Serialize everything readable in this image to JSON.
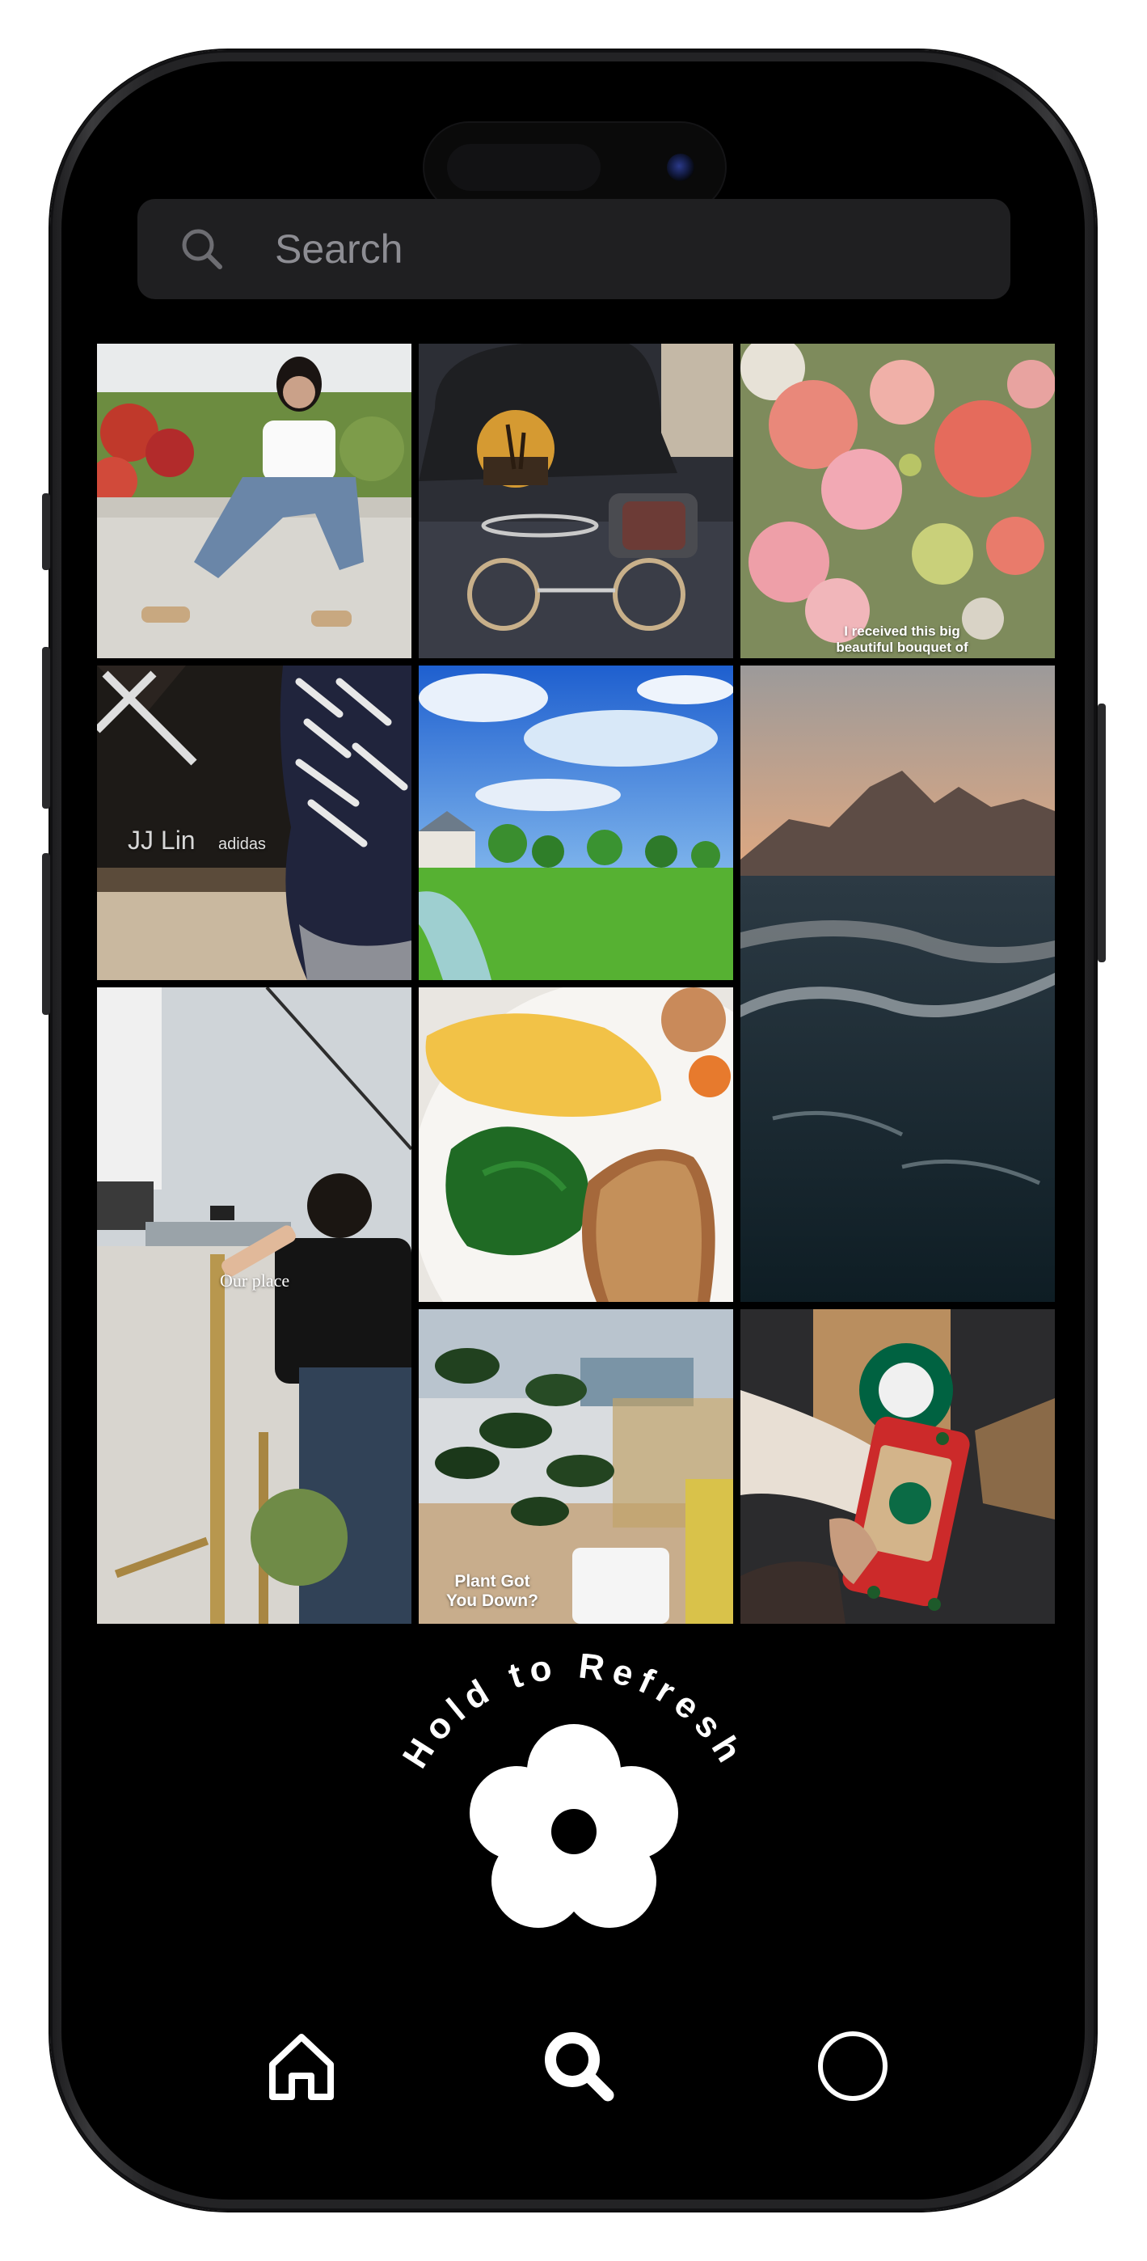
{
  "search": {
    "placeholder": "Search",
    "icon": "search-icon"
  },
  "grid": {
    "tiles": [
      {
        "name": "woman-sitting-on-wall-photo",
        "caption": ""
      },
      {
        "name": "cap-watch-glasses-photo",
        "caption": ""
      },
      {
        "name": "flower-bouquet-photo",
        "caption_line1": "I received this big",
        "caption_line2": "beautiful bouquet of"
      },
      {
        "name": "adidas-sneaker-photo",
        "brand_text": "JJ Lin",
        "logo_text": "adidas"
      },
      {
        "name": "green-lawn-blue-sky-photo",
        "caption": ""
      },
      {
        "name": "mountain-beach-video",
        "caption": ""
      },
      {
        "name": "bamboo-fence-video",
        "caption": "Our place"
      },
      {
        "name": "omelette-breakfast-photo",
        "caption": ""
      },
      {
        "name": "plant-video",
        "caption_line1": "Plant Got",
        "caption_line2": "You Down?"
      },
      {
        "name": "starbucks-cup-photo",
        "caption": ""
      }
    ]
  },
  "refresh": {
    "label": "Hold to Refresh",
    "icon": "flower-icon"
  },
  "tabbar": {
    "items": [
      {
        "name": "home",
        "icon": "home-icon"
      },
      {
        "name": "search",
        "icon": "search-icon",
        "active": true
      },
      {
        "name": "profile",
        "icon": "circle-icon"
      }
    ]
  },
  "colors": {
    "background": "#000000",
    "search_bg": "#1f1f21",
    "placeholder": "#8d8d93",
    "foreground": "#ffffff"
  }
}
